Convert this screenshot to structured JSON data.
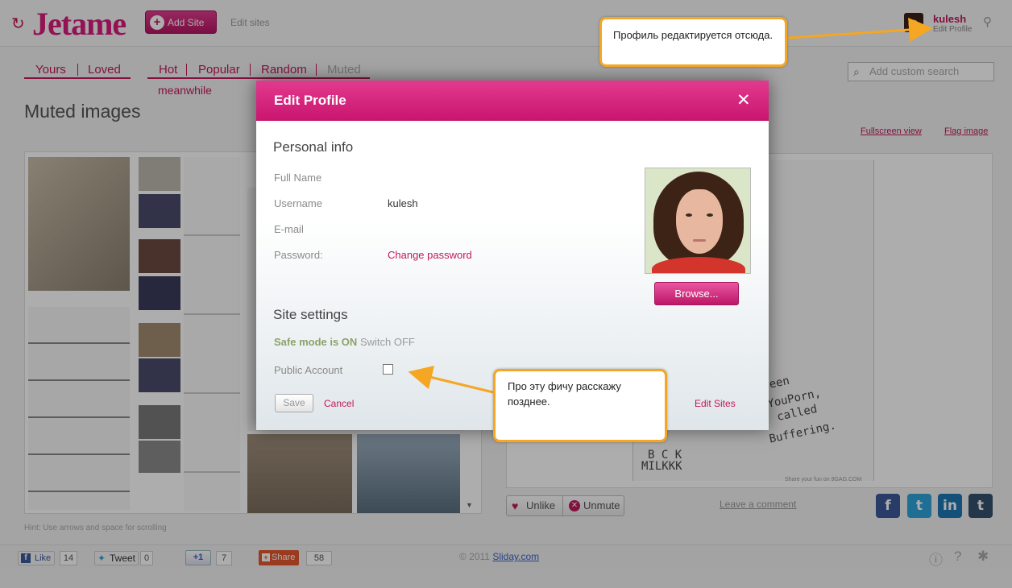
{
  "header": {
    "logo_text": "Jetame",
    "add_site_label": "Add Site",
    "edit_sites_label": "Edit sites",
    "user_name": "kulesh",
    "edit_profile_label": "Edit Profile"
  },
  "tabs_left": [
    "Yours",
    "Loved"
  ],
  "tabs_mid": [
    "Hot",
    "Popular",
    "Random",
    "Muted"
  ],
  "sub_tab": "meanwhile",
  "page_title": "Muted images",
  "search": {
    "placeholder": "Add custom search"
  },
  "image_links": {
    "fullscreen": "Fullscreen view",
    "flag": "Flag image"
  },
  "hint": "Hint: Use arrows and space for scrolling",
  "actions": {
    "unlike": "Unlike",
    "unmute": "Unmute",
    "leave_comment": "Leave a comment"
  },
  "comic": {
    "texts": [
      "Green",
      "YouPorn,",
      "called",
      "Buffering.",
      "B C K",
      "MILKKK"
    ],
    "credit": "Share your fun on 9GAG.COM"
  },
  "social_icons": [
    {
      "name": "facebook-icon",
      "glyph": "f",
      "color": "#3b5998"
    },
    {
      "name": "twitter-icon",
      "glyph": "t",
      "color": "#2ea2d9"
    },
    {
      "name": "linkedin-icon",
      "glyph": "in",
      "color": "#1e78b4"
    },
    {
      "name": "tumblr-icon",
      "glyph": "t",
      "color": "#36506d"
    }
  ],
  "footer": {
    "like_label": "Like",
    "like_count": "14",
    "tweet_label": "Tweet",
    "tweet_count": "0",
    "gplus_label": "+1",
    "gplus_count": "7",
    "share_label": "Share",
    "share_count": "58",
    "copyright_prefix": "© 2011",
    "copyright_link": "Sliday.com"
  },
  "modal": {
    "title": "Edit Profile",
    "personal_info": "Personal info",
    "full_name_label": "Full Name",
    "username_label": "Username",
    "username_value": "kulesh",
    "email_label": "E-mail",
    "password_label": "Password:",
    "change_password": "Change password",
    "browse_label": "Browse...",
    "site_settings": "Site settings",
    "safe_mode_text": "Safe mode is ON",
    "switch_off": "Switch OFF",
    "public_account_label": "Public Account",
    "public_account_checked": false,
    "save_label": "Save",
    "cancel_label": "Cancel",
    "edit_sites_label": "Edit Sites"
  },
  "callouts": {
    "profile_note": "Профиль редактируется отсюда.",
    "feature_note": "Про эту фичу расскажу позднее."
  },
  "colors": {
    "accent": "#c2185b",
    "callout_border": "#f5a623"
  }
}
